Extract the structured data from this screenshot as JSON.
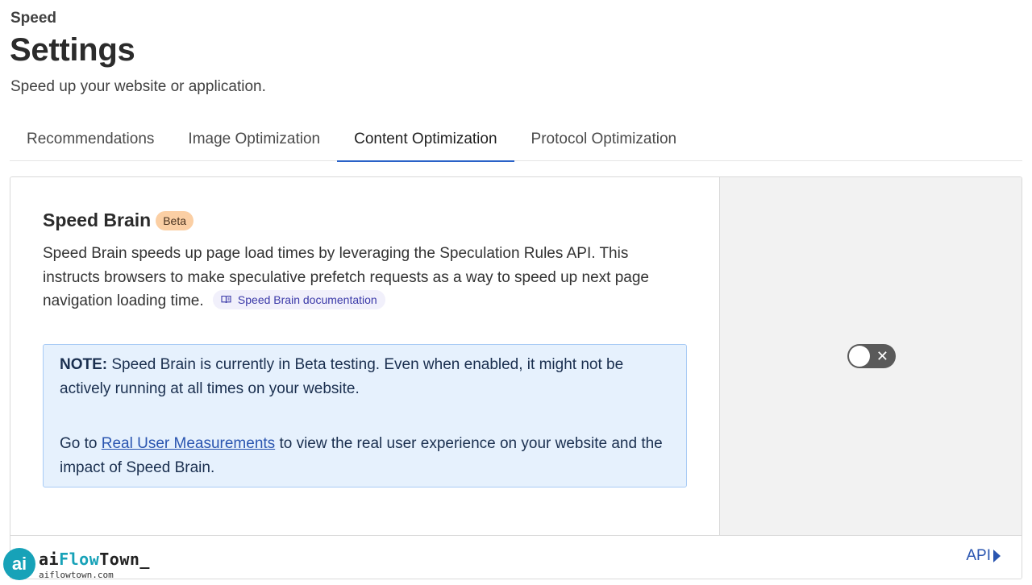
{
  "breadcrumb": "Speed",
  "page_title": "Settings",
  "page_subtitle": "Speed up your website or application.",
  "tabs": [
    {
      "label": "Recommendations",
      "active": false
    },
    {
      "label": "Image Optimization",
      "active": false
    },
    {
      "label": "Content Optimization",
      "active": true
    },
    {
      "label": "Protocol Optimization",
      "active": false
    }
  ],
  "speed_brain": {
    "title": "Speed Brain",
    "badge": "Beta",
    "description": "Speed Brain speeds up page load times by leveraging the Speculation Rules API. This instructs browsers to make speculative prefetch requests as a way to speed up next page navigation loading time.",
    "doc_link": {
      "label": "Speed Brain documentation",
      "icon": "book-icon"
    },
    "note": {
      "label": "NOTE:",
      "text": " Speed Brain is currently in Beta testing. Even when enabled, it might not be actively running at all times on your website.",
      "goto_prefix": "Go to ",
      "link_text": "Real User Measurements",
      "goto_suffix": " to view the real user experience on your website and the impact of Speed Brain."
    },
    "toggle": {
      "enabled": false,
      "off_glyph": "✕"
    }
  },
  "footer": {
    "api_label": "API"
  },
  "watermark": {
    "logo": "ai",
    "brand_prefix": "ai",
    "brand_accent": "Flow",
    "brand_suffix": "Town_",
    "url": "aiflowtown.com"
  },
  "colors": {
    "accent": "#2a62c8",
    "link": "#2a55b0",
    "beta_badge": "#fbcfa4",
    "note_bg": "#e6f1fd"
  }
}
